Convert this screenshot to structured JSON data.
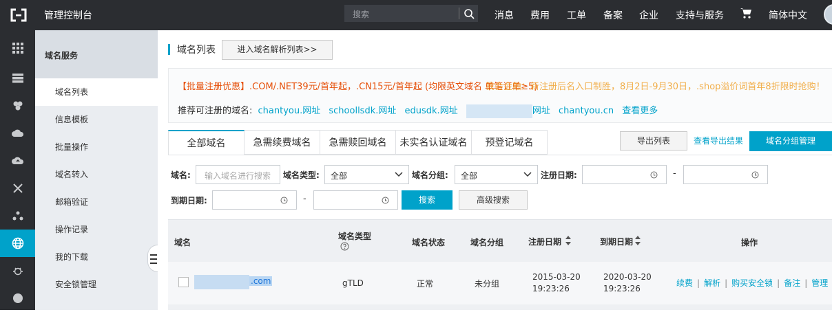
{
  "header": {
    "title": "管理控制台",
    "search_placeholder": "搜索",
    "nav": [
      "消息",
      "费用",
      "工单",
      "备案",
      "企业",
      "支持与服务",
      "简体中文"
    ]
  },
  "sidebar": {
    "title": "域名服务",
    "items": [
      {
        "label": "域名列表",
        "active": true
      },
      {
        "label": "信息模板"
      },
      {
        "label": "批量操作"
      },
      {
        "label": "域名转入"
      },
      {
        "label": "邮箱验证"
      },
      {
        "label": "操作记录"
      },
      {
        "label": "我的下载"
      },
      {
        "label": "安全锁管理"
      }
    ]
  },
  "page": {
    "title": "域名列表",
    "goto_dns_button": "进入域名解析列表>>"
  },
  "promo": {
    "line1": "【批量注册优惠】.COM/.NET39元/首年起，.CN15元/首年起 (均限英文域名 单笔订单≥5)",
    "line1_overlap": "我会金融：新注册后名入口制胜，8月2日-9月30日，.shop溢价词首年8折限时抢购！",
    "recommend_label": "推荐可注册的域名:",
    "recommend": [
      "chantyou.网址",
      "schoollsdk.网址",
      "edusdk.网址",
      "网址",
      "chantyou.cn"
    ],
    "more": "查看更多"
  },
  "tabs": [
    "全部域名",
    "急需续费域名",
    "急需赎回域名",
    "未实名认证域名",
    "预登记域名"
  ],
  "actions": {
    "export": "导出列表",
    "export_result": "查看导出结果",
    "group_manage": "域名分组管理"
  },
  "filters": {
    "domain_label": "域名:",
    "domain_placeholder": "输入域名进行搜索",
    "type_label": "域名类型:",
    "type_value": "全部",
    "group_label": "域名分组:",
    "group_value": "全部",
    "reg_date_label": "注册日期:",
    "exp_date_label": "到期日期:",
    "dash": "-",
    "search_button": "搜索",
    "advanced_button": "高级搜索"
  },
  "table": {
    "columns": [
      "域名",
      "域名类型",
      "域名状态",
      "域名分组",
      "注册日期",
      "到期日期",
      "操作"
    ],
    "rows": [
      {
        "domain_suffix": ".com",
        "type": "gTLD",
        "status": "正常",
        "group": "未分组",
        "reg_date": "2015-03-20",
        "reg_time": "19:23:26",
        "exp_date": "2020-03-20",
        "exp_time": "19:23:26",
        "ops": [
          "续费",
          "解析",
          "购买安全锁",
          "备注",
          "管理"
        ]
      }
    ]
  },
  "colors": {
    "topbar": "#2b2d31",
    "accent": "#00a2ca",
    "promo_text": "#e6500a"
  }
}
